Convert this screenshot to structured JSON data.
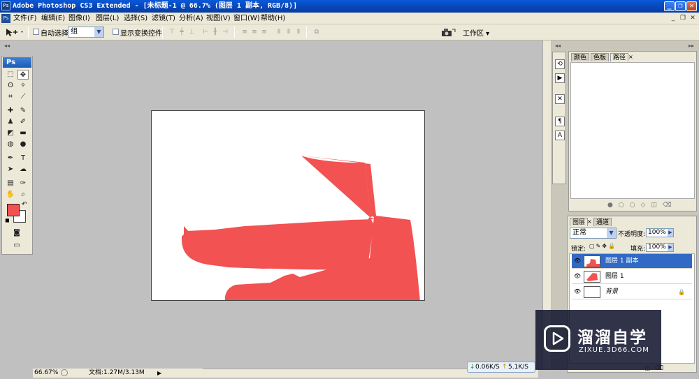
{
  "window": {
    "app_icon": "Ps",
    "title": "Adobe Photoshop CS3 Extended - [未标题-1 @ 66.7% (图层 1 副本, RGB/8)]",
    "controls": [
      "_",
      "❐",
      "✕"
    ]
  },
  "menubar": {
    "doc_icon": "Ps",
    "items": [
      "文件(F)",
      "编辑(E)",
      "图像(I)",
      "图层(L)",
      "选择(S)",
      "滤镜(T)",
      "分析(A)",
      "视图(V)",
      "窗口(W)",
      "帮助(H)"
    ],
    "doc_controls": [
      "_",
      "❐",
      "✕"
    ]
  },
  "options": {
    "auto_select_label": "自动选择:",
    "auto_select_value": "组",
    "show_transform_label": "显示变换控件",
    "workspace_label": "工作区 ▾"
  },
  "toolbox": {
    "logo": "Ps"
  },
  "colors": {
    "foreground": "#f25252",
    "background": "#ffffff",
    "shoe": "#f25252",
    "layer_selected": "#316ac5"
  },
  "status": {
    "zoom": "66.67%",
    "doc_size": "文档:1.27M/3.13M"
  },
  "panels": {
    "top_tabs": [
      "颜色",
      "色板",
      "路径"
    ],
    "layers_tabs": [
      "图层",
      "通道"
    ],
    "blend_mode": "正常",
    "opacity_label": "不透明度:",
    "opacity_value": "100%",
    "lock_label": "锁定:",
    "fill_label": "填充:",
    "fill_value": "100%",
    "layers": [
      {
        "name": "图层 1 副本",
        "selected": true
      },
      {
        "name": "图层 1",
        "selected": false
      },
      {
        "name": "背景",
        "selected": false
      }
    ]
  },
  "watermark": {
    "name": "溜溜自学",
    "url": "ZIXUE.3D66.COM"
  },
  "net_speed": {
    "down": "0.06K/S",
    "up": "5.1K/S"
  }
}
